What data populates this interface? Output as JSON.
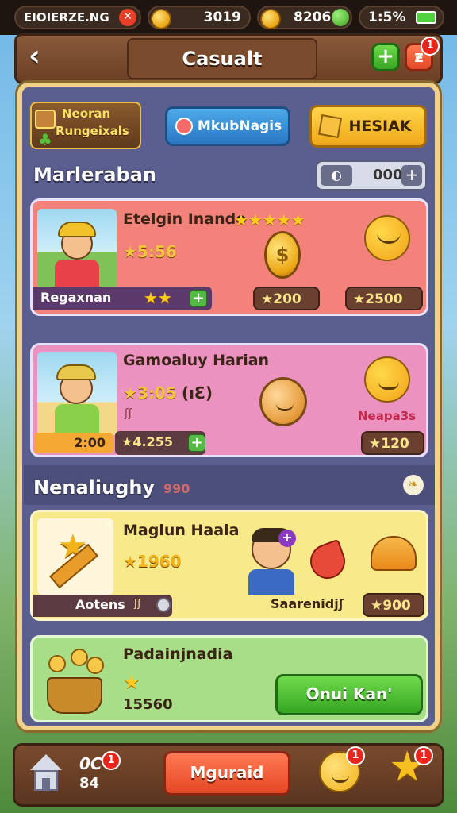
{
  "status_bar": {
    "carrier": "EIOIERZE.NG",
    "close_icon": "close-icon",
    "coins_value": "3019",
    "gems_value": "8206",
    "battery": "1:5%",
    "battery_icon": "battery-icon"
  },
  "header": {
    "back_icon": "back-arrow-icon",
    "title": "Casualt",
    "add_icon": "plus-icon",
    "notif_icon": "fire-icon",
    "notif_badge": "1"
  },
  "top_banner": {
    "logo_line1": "Neoran",
    "logo_line2": "Rungeixals",
    "btn_blue_label": "MkubNagis",
    "btn_yellow_label": "HESIAK"
  },
  "section1": {
    "title": "Marleraban",
    "counter_value": "000"
  },
  "cards": [
    {
      "name": "Etelgin Inando",
      "stars_text": "★★★★★",
      "price_text": "★5:56",
      "footer_label": "Regaxnan",
      "footer_stars": "★★",
      "price1": "★200",
      "price2": "★2500"
    },
    {
      "name": "Gamoaluy Harian",
      "price_text": "★3:05",
      "extra_text": "(ıƐ)",
      "sub_text": "ʃʃ",
      "footer_value": "2:00",
      "footer_value2": "★4.255",
      "side_label": "Neapa3s",
      "price1": "★120"
    }
  ],
  "section2": {
    "title": "Nenaliughy",
    "sub_text": "990"
  },
  "cards2": [
    {
      "name": "Maglun Haala",
      "price_text": "★1960",
      "footer_label": "Aotens",
      "footer_small": "ʃʃ",
      "mid_label": "Saarenidjʃ",
      "price1": "★900"
    },
    {
      "name": "Padainjnadia",
      "stars_text": "★",
      "price_text": "15560",
      "button_label": "Onui Kan'"
    }
  ],
  "bottom_nav": {
    "home_icon": "home-icon",
    "count_top": "0C",
    "count_bottom": "84",
    "badge1": "1",
    "center_button": "Mguraid",
    "badge2": "1",
    "badge3": "1"
  },
  "colors": {
    "panel": "#5b5f8f",
    "card1": "#f2827a",
    "card2": "#ec92c0",
    "card3": "#f8e98a",
    "card4": "#a8de88"
  }
}
